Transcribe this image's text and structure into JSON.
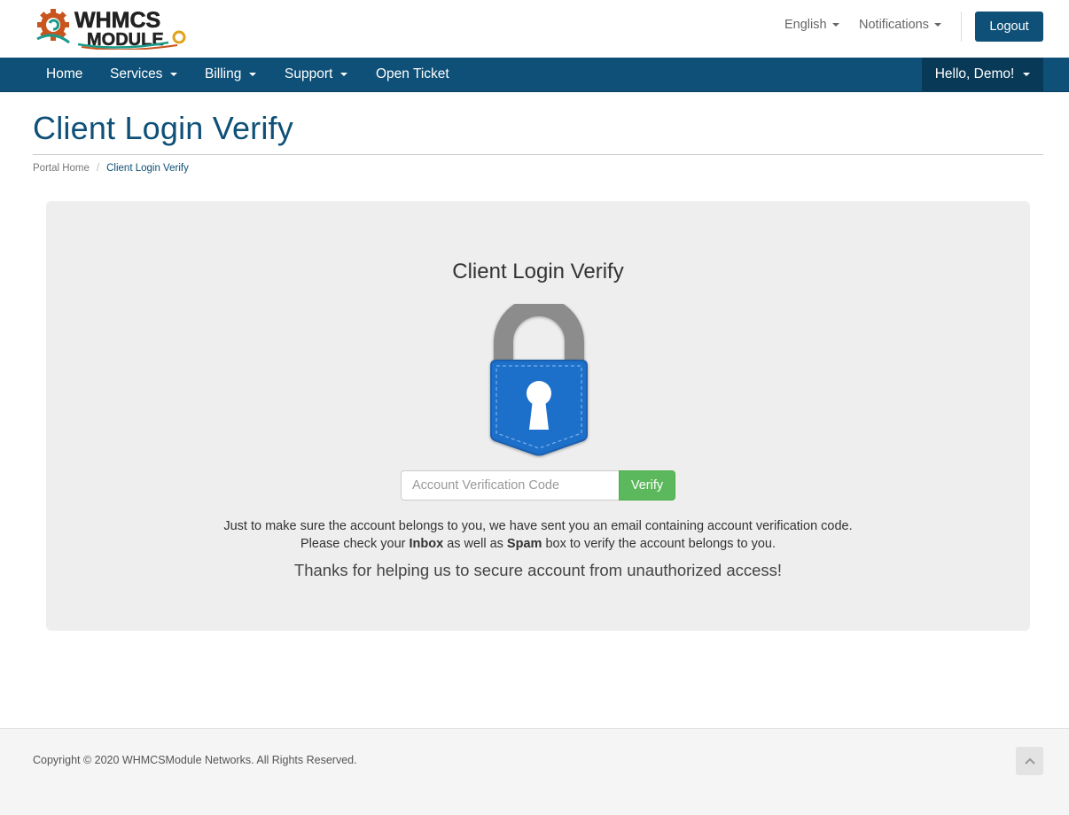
{
  "header": {
    "logo_icon": "whmcs-module-logo",
    "logo_line1": "WHMCS",
    "logo_line2": "MODULE",
    "language": "English",
    "notifications": "Notifications",
    "logout": "Logout"
  },
  "nav": {
    "items": [
      {
        "label": "Home"
      },
      {
        "label": "Services"
      },
      {
        "label": "Billing"
      },
      {
        "label": "Support"
      },
      {
        "label": "Open Ticket"
      }
    ],
    "user": "Hello, Demo!"
  },
  "page": {
    "title": "Client Login Verify",
    "breadcrumb": [
      "Portal Home",
      "Client Login Verify"
    ]
  },
  "verify": {
    "heading": "Client Login Verify",
    "lock_icon": "padlock-icon",
    "input_placeholder": "Account Verification Code",
    "input_value": "",
    "button": "Verify",
    "msg1": "Just to make sure the account belongs to you, we have sent you an email containing account verification code.",
    "msg2_pre": "Please check your ",
    "msg2_inbox": "Inbox",
    "msg2_mid": " as well as ",
    "msg2_spam": "Spam",
    "msg2_post": " box to verify the account belongs to you.",
    "thanks": "Thanks for helping us to secure account from unauthorized access!"
  },
  "footer": {
    "copyright": "Copyright © 2020 WHMCSModule Networks. All Rights Reserved.",
    "back_to_top_icon": "chevron-up-icon"
  },
  "colors": {
    "brand": "#0e5077",
    "nav_user_bg": "#083a57",
    "verify_green": "#5cb85c",
    "lock_blue": "#1f6fc9",
    "panel_bg": "#eeeeee"
  }
}
